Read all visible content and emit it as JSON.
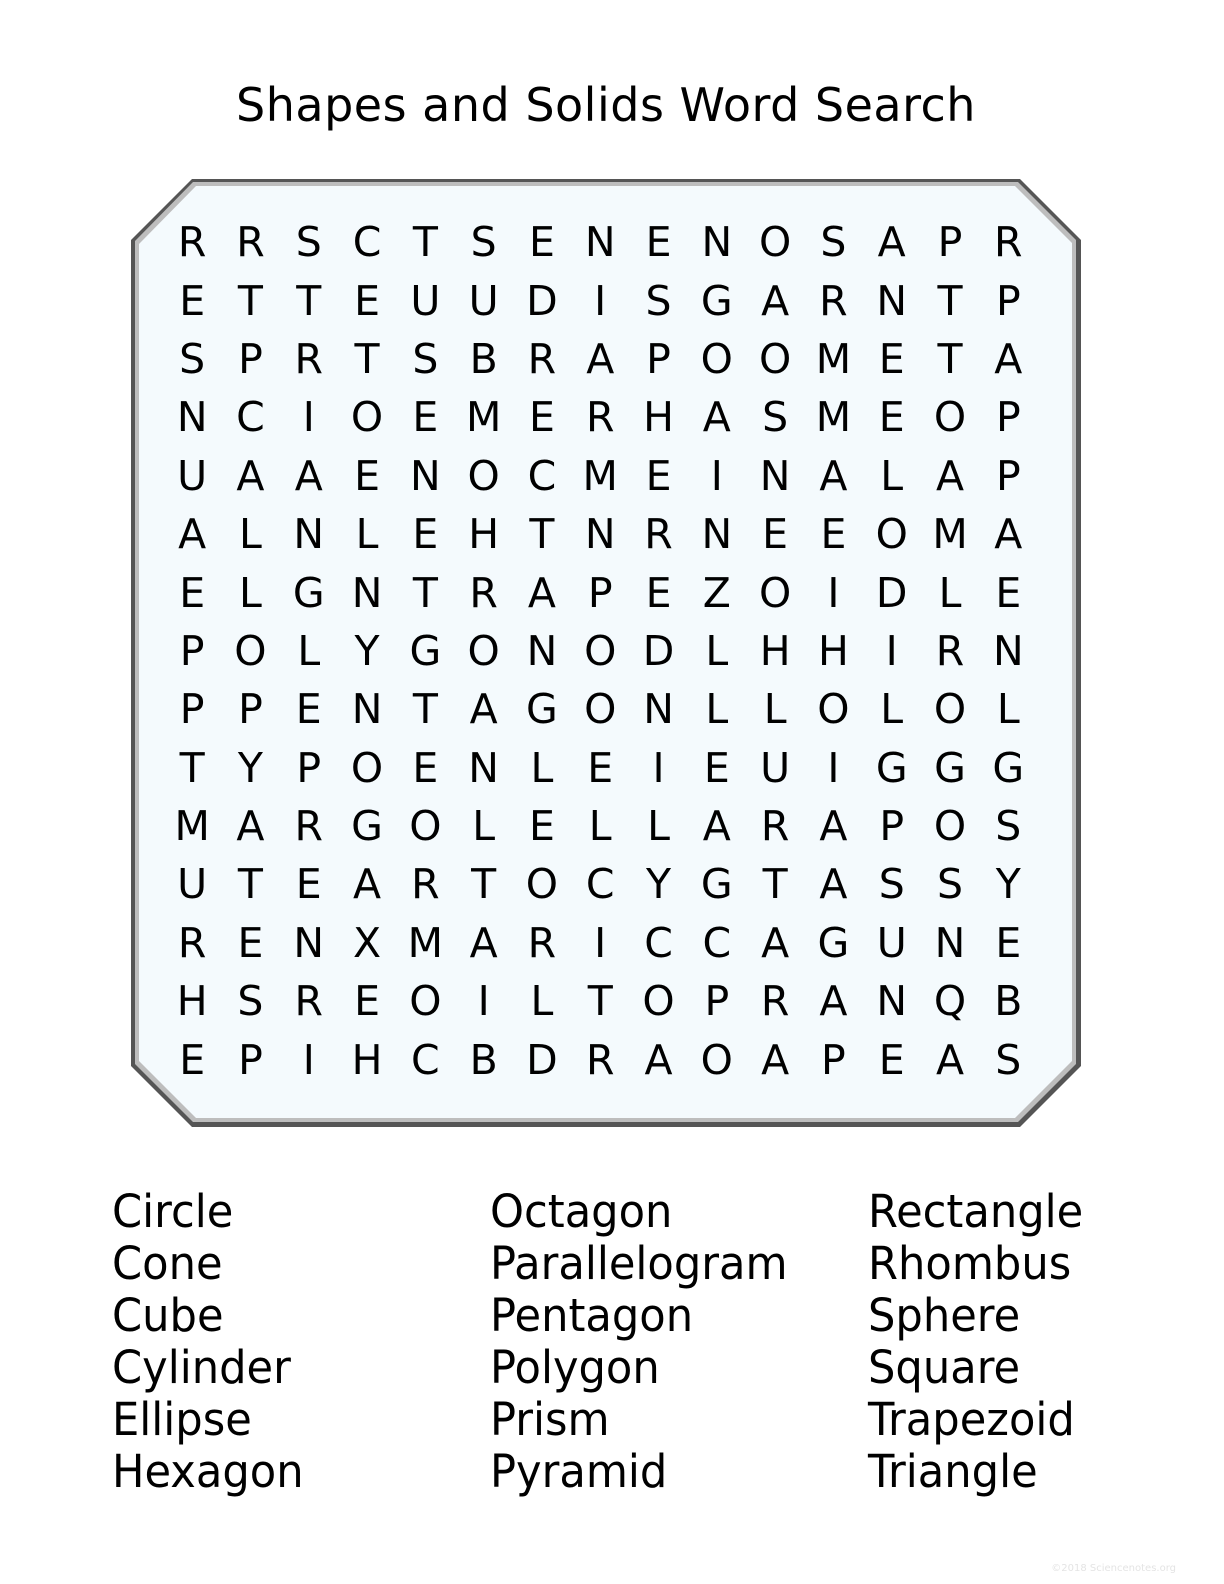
{
  "title": "Shapes and Solids Word Search",
  "colors": {
    "board_fill": "#f4fafd",
    "board_border": "#888888"
  },
  "grid": [
    [
      "R",
      "R",
      "S",
      "C",
      "T",
      "S",
      "E",
      "N",
      "E",
      "N",
      "O",
      "S",
      "A",
      "P",
      "R"
    ],
    [
      "E",
      "T",
      "T",
      "E",
      "U",
      "U",
      "D",
      "I",
      "S",
      "G",
      "A",
      "R",
      "N",
      "T",
      "P"
    ],
    [
      "S",
      "P",
      "R",
      "T",
      "S",
      "B",
      "R",
      "A",
      "P",
      "O",
      "O",
      "M",
      "E",
      "T",
      "A"
    ],
    [
      "N",
      "C",
      "I",
      "O",
      "E",
      "M",
      "E",
      "R",
      "H",
      "A",
      "S",
      "M",
      "E",
      "O",
      "P"
    ],
    [
      "U",
      "A",
      "A",
      "E",
      "N",
      "O",
      "C",
      "M",
      "E",
      "I",
      "N",
      "A",
      "L",
      "A",
      "P"
    ],
    [
      "A",
      "L",
      "N",
      "L",
      "E",
      "H",
      "T",
      "N",
      "R",
      "N",
      "E",
      "E",
      "O",
      "M",
      "A"
    ],
    [
      "E",
      "L",
      "G",
      "N",
      "T",
      "R",
      "A",
      "P",
      "E",
      "Z",
      "O",
      "I",
      "D",
      "L",
      "E"
    ],
    [
      "P",
      "O",
      "L",
      "Y",
      "G",
      "O",
      "N",
      "O",
      "D",
      "L",
      "H",
      "H",
      "I",
      "R",
      "N"
    ],
    [
      "P",
      "P",
      "E",
      "N",
      "T",
      "A",
      "G",
      "O",
      "N",
      "L",
      "L",
      "O",
      "L",
      "O",
      "L"
    ],
    [
      "T",
      "Y",
      "P",
      "O",
      "E",
      "N",
      "L",
      "E",
      "I",
      "E",
      "U",
      "I",
      "G",
      "G",
      "G"
    ],
    [
      "M",
      "A",
      "R",
      "G",
      "O",
      "L",
      "E",
      "L",
      "L",
      "A",
      "R",
      "A",
      "P",
      "O",
      "S"
    ],
    [
      "U",
      "T",
      "E",
      "A",
      "R",
      "T",
      "O",
      "C",
      "Y",
      "G",
      "T",
      "A",
      "S",
      "S",
      "Y"
    ],
    [
      "R",
      "E",
      "N",
      "X",
      "M",
      "A",
      "R",
      "I",
      "C",
      "C",
      "A",
      "G",
      "U",
      "N",
      "E"
    ],
    [
      "H",
      "S",
      "R",
      "E",
      "O",
      "I",
      "L",
      "T",
      "O",
      "P",
      "R",
      "A",
      "N",
      "Q",
      "B"
    ],
    [
      "E",
      "P",
      "I",
      "H",
      "C",
      "B",
      "D",
      "R",
      "A",
      "O",
      "A",
      "P",
      "E",
      "A",
      "S"
    ]
  ],
  "word_columns": [
    [
      "Circle",
      "Cone",
      "Cube",
      "Cylinder",
      "Ellipse",
      "Hexagon"
    ],
    [
      "Octagon",
      "Parallelogram",
      "Pentagon",
      "Polygon",
      "Prism",
      "Pyramid"
    ],
    [
      "Rectangle",
      "Rhombus",
      "Sphere",
      "Square",
      "Trapezoid",
      "Triangle"
    ]
  ],
  "footer": "©2018 Sciencenotes.org"
}
